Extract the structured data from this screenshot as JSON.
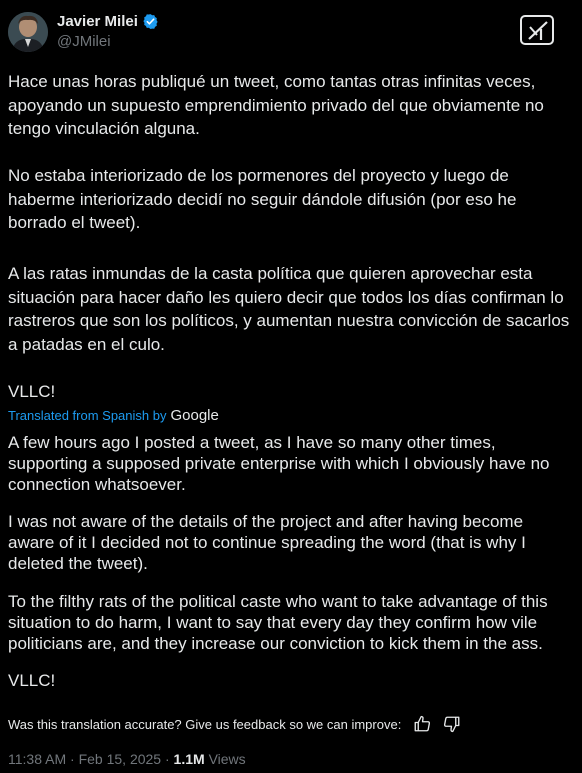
{
  "author": {
    "name": "Javier Milei",
    "handle": "@JMilei"
  },
  "tweet": {
    "paragraphs": [
      "Hace unas horas publiqué un tweet, como tantas otras infinitas veces, apoyando un supuesto emprendimiento privado del que obviamente no tengo vinculación alguna.",
      "No estaba interiorizado de los pormenores del proyecto y luego de haberme interiorizado decidí no seguir dándole difusión (por eso he borrado el tweet).",
      "A las ratas inmundas de la casta política que quieren aprovechar esta situación para hacer daño les quiero decir que todos los días confirman lo rastreros que son los políticos, y aumentan nuestra convicción de sacarlos a patadas en el culo.",
      "VLLC!"
    ]
  },
  "translation": {
    "label": "Translated from Spanish by",
    "provider": "Google",
    "paragraphs": [
      "A few hours ago I posted a tweet, as I have so many other times, supporting a supposed private enterprise with which I obviously have no connection whatsoever.",
      "I was not aware of the details of the project and after having become aware of it I decided not to continue spreading the word (that is why I deleted the tweet).",
      "To the filthy rats of the political caste who want to take advantage of this situation to do harm, I want to say that every day they confirm how vile politicians are, and they increase our conviction to kick them in the ass.",
      "VLLC!"
    ],
    "feedback_prompt": "Was this translation accurate? Give us feedback so we can improve:"
  },
  "meta": {
    "time": "11:38 AM",
    "separator": "·",
    "date": "Feb 15, 2025",
    "views_count": "1.1M",
    "views_label": "Views"
  },
  "icons": {
    "verified": "verified-badge-icon",
    "grok": "grok-icon",
    "thumbs_up": "thumbs-up-icon",
    "thumbs_down": "thumbs-down-icon"
  },
  "colors": {
    "background": "#000000",
    "text": "#e7e9ea",
    "muted": "#71767b",
    "link": "#1d9bf0",
    "verified": "#1d9bf0"
  }
}
